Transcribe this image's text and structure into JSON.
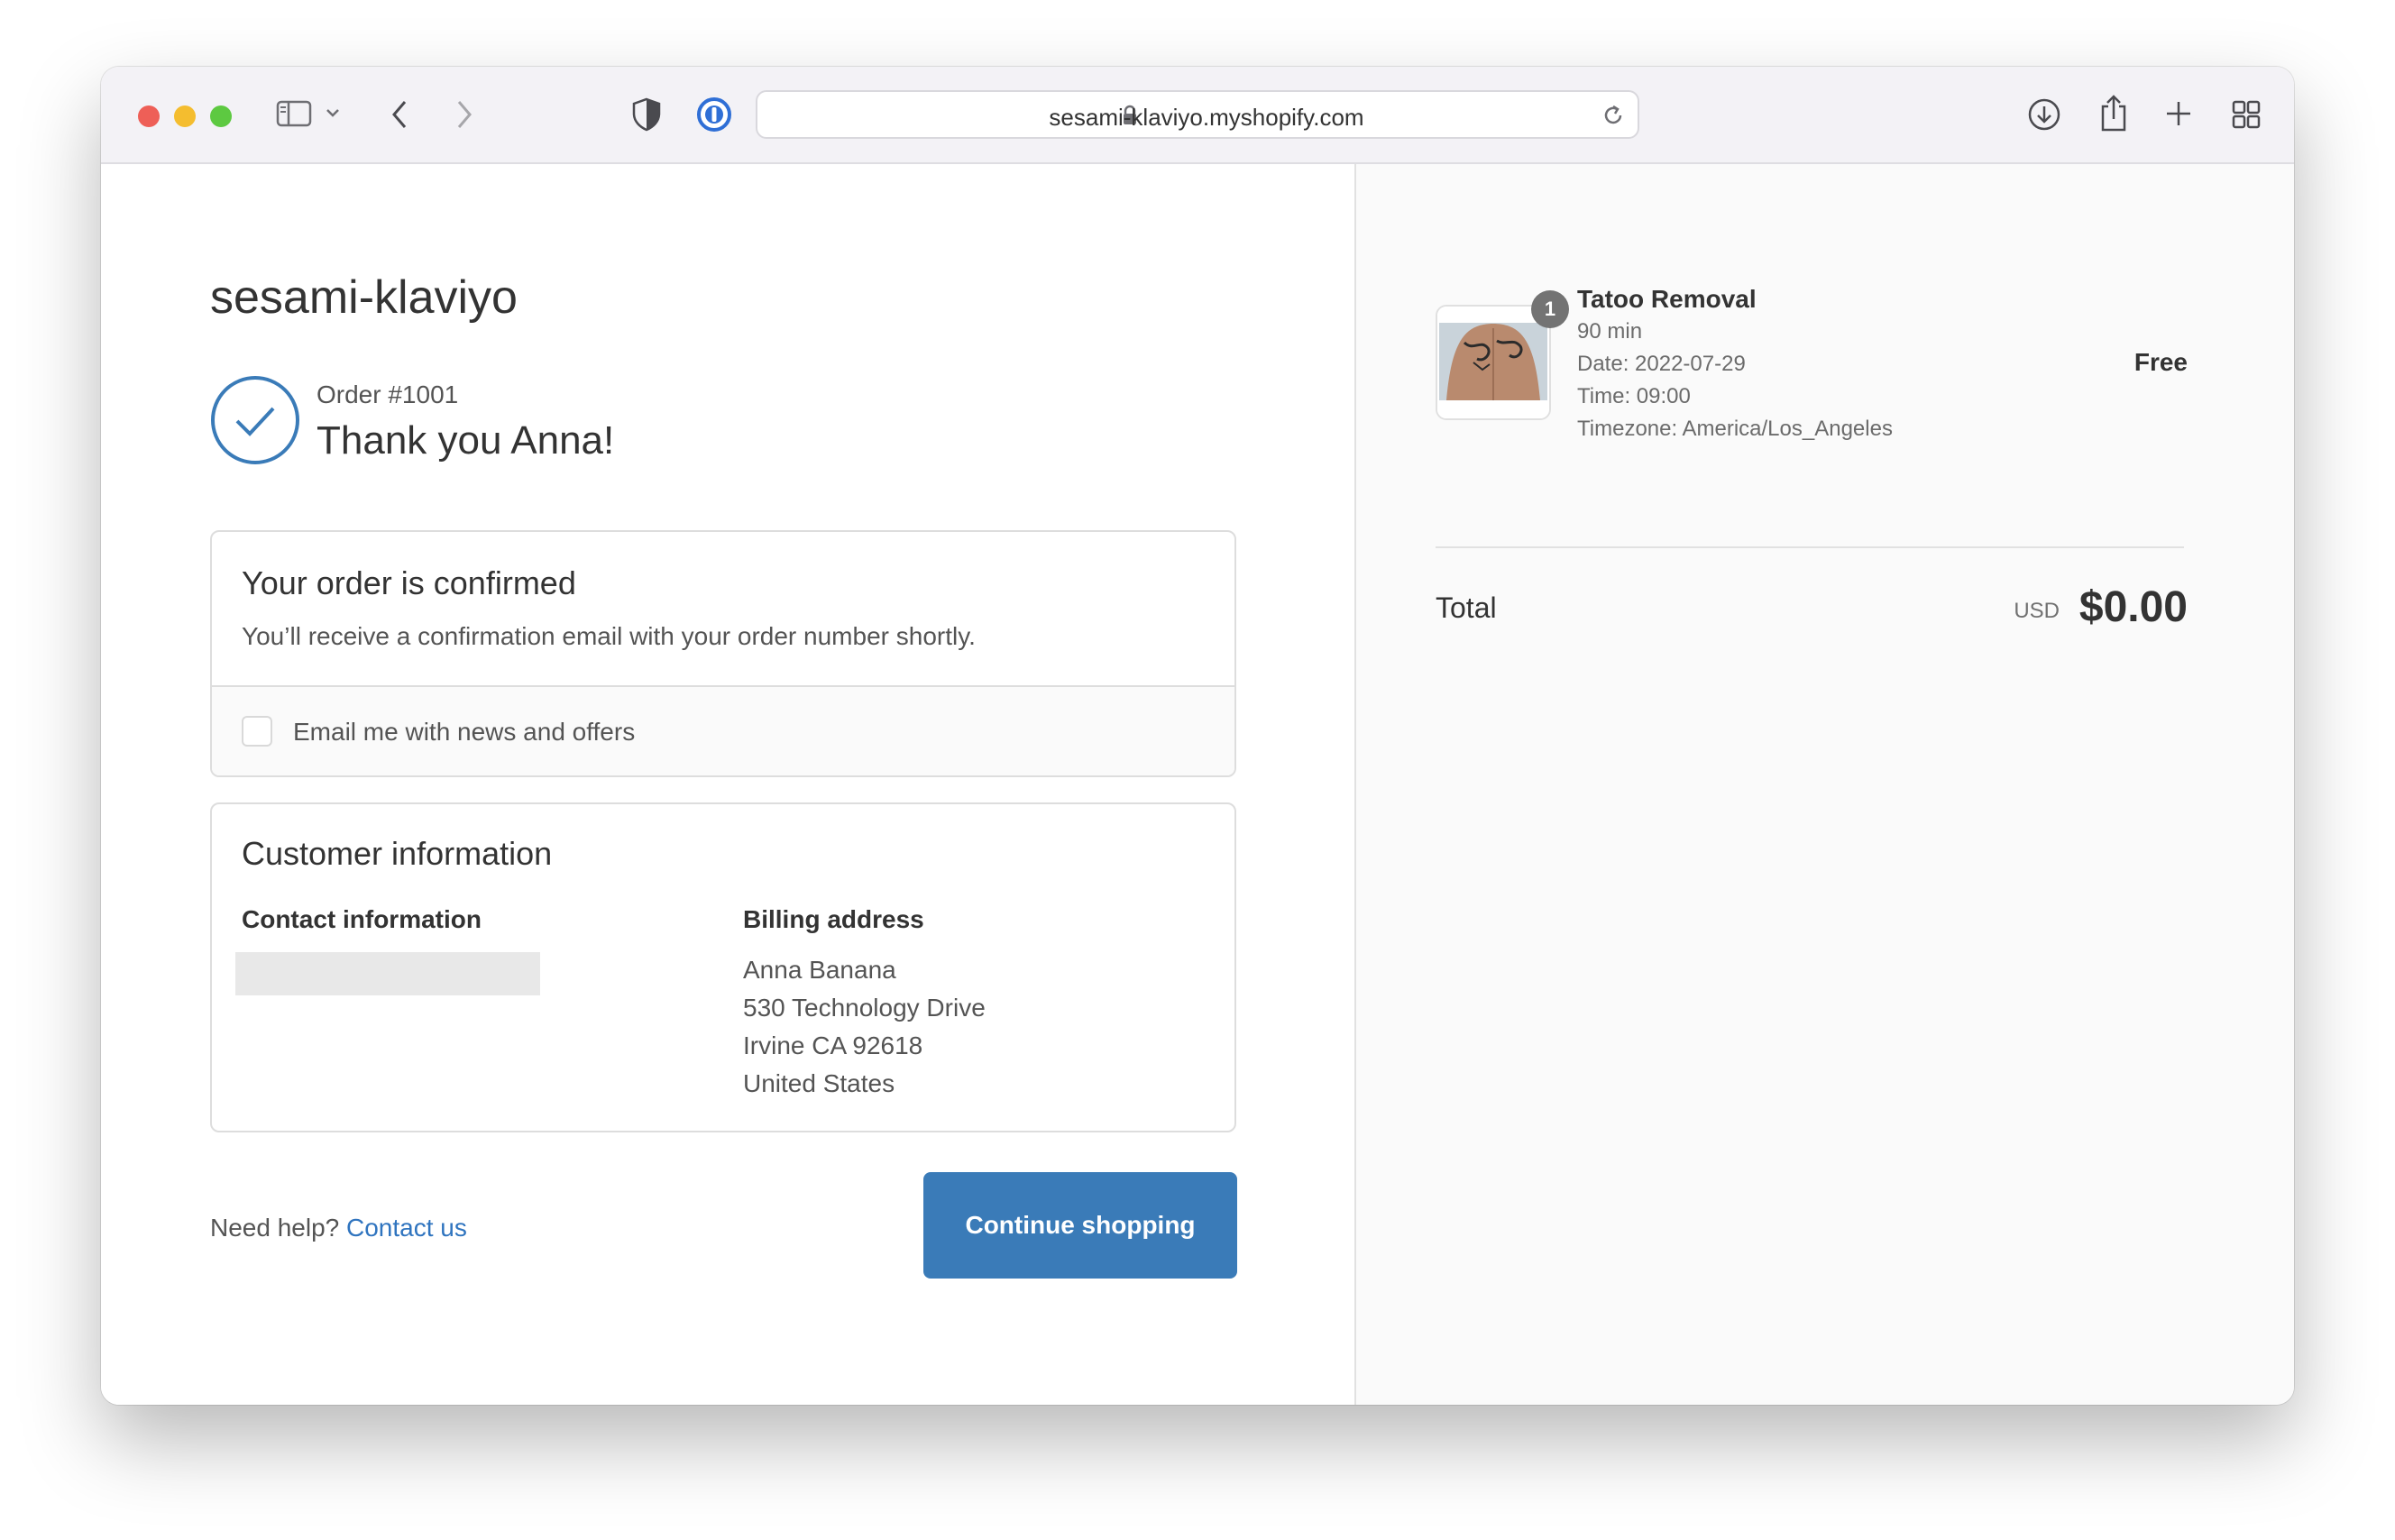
{
  "browser": {
    "url": "sesami-klaviyo.myshopify.com",
    "icons": [
      "sidebar-icon",
      "chevron-down-icon",
      "back-icon",
      "forward-icon",
      "shield-icon",
      "password-manager-icon",
      "lock-icon",
      "reload-icon",
      "download-icon",
      "share-icon",
      "new-tab-icon",
      "tab-overview-icon"
    ]
  },
  "shop": {
    "name": "sesami-klaviyo"
  },
  "order": {
    "number": "Order #1001",
    "thanks": "Thank you Anna!"
  },
  "confirmation": {
    "title": "Your order is confirmed",
    "text": "You’ll receive a confirmation email with your order number shortly.",
    "newsletter_label": "Email me with news and offers"
  },
  "customer": {
    "title": "Customer information",
    "contact_heading": "Contact information",
    "billing_heading": "Billing address",
    "billing": [
      "Anna Banana",
      "530 Technology Drive",
      "Irvine CA 92618",
      "United States"
    ]
  },
  "footer": {
    "help_text": "Need help?",
    "contact_link": "Contact us",
    "continue_label": "Continue shopping"
  },
  "summary": {
    "item": {
      "quantity": "1",
      "title": "Tatoo Removal",
      "duration": "90 min",
      "date": "Date: 2022-07-29",
      "time": "Time: 09:00",
      "timezone": "Timezone: America/Los_Angeles",
      "price": "Free"
    },
    "total_label": "Total",
    "currency": "USD",
    "total": "$0.00"
  },
  "colors": {
    "accent": "#3a7bb8",
    "link": "#2f74bf",
    "sidebar_bg": "#fafafa"
  }
}
